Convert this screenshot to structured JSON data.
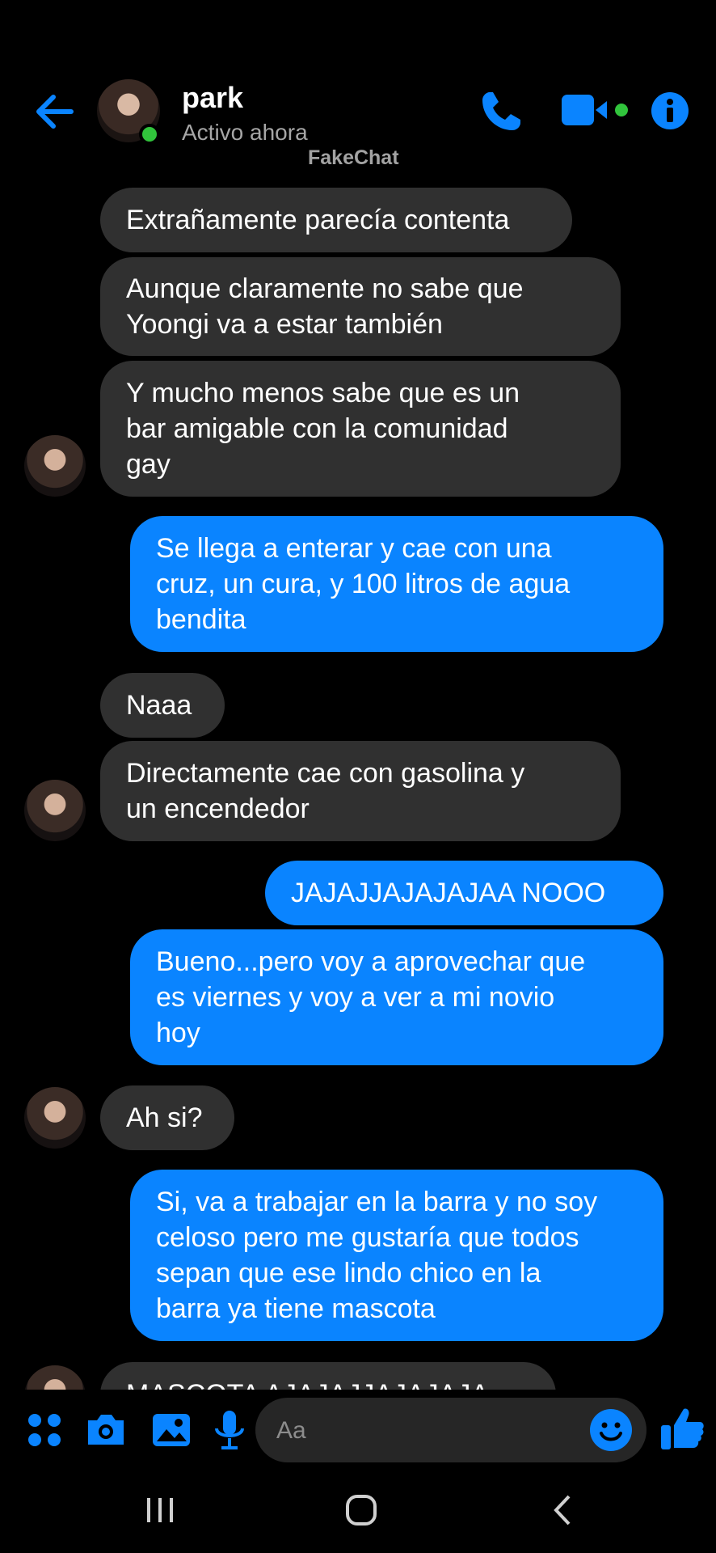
{
  "header": {
    "name": "park",
    "status": "Activo ahora",
    "watermark": "FakeChat"
  },
  "colors": {
    "accent": "#0a84ff",
    "incoming": "#303030",
    "online": "#31c43c"
  },
  "messages": [
    {
      "side": "in",
      "text": "Extrañamente parecía contenta"
    },
    {
      "side": "in",
      "text": "Aunque claramente no sabe que\nYoongi va a estar también"
    },
    {
      "side": "in",
      "text": "Y mucho menos sabe que es un\nbar amigable con la comunidad\ngay"
    },
    {
      "side": "out",
      "text": "Se llega a enterar y cae con una\ncruz, un cura, y 100 litros de agua\nbendita"
    },
    {
      "side": "in",
      "text": "Naaa"
    },
    {
      "side": "in",
      "text": "Directamente cae con gasolina y\nun encendedor"
    },
    {
      "side": "out",
      "text": "JAJAJJAJAJAJAA NOOO"
    },
    {
      "side": "out",
      "text": "Bueno...pero voy a aprovechar que\nes viernes y voy a ver a mi novio\nhoy"
    },
    {
      "side": "in",
      "text": "Ah si?"
    },
    {
      "side": "out",
      "text": "Si, va a trabajar en la barra y no soy\nceloso pero me gustaría que todos\nsepan que ese lindo chico en la\nbarra ya tiene mascota"
    },
    {
      "side": "in",
      "text": "MASCOTA AJAJAJJAJAJAJA"
    }
  ],
  "composer": {
    "placeholder": "Aa",
    "icons": [
      "menu-icon",
      "camera-icon",
      "gallery-icon",
      "microphone-icon",
      "emoji-icon",
      "thumbs-up-icon"
    ]
  }
}
